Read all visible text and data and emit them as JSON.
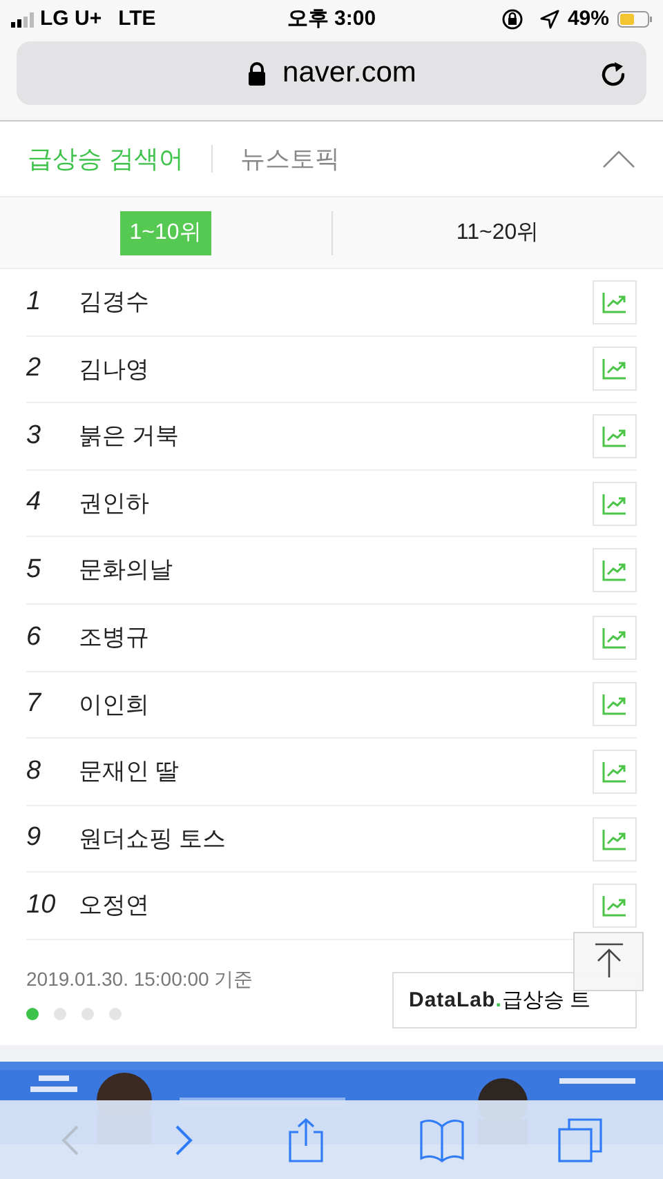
{
  "status_bar": {
    "carrier": "LG U+",
    "network": "LTE",
    "time": "오후 3:00",
    "battery": "49%"
  },
  "address_bar": {
    "url": "naver.com"
  },
  "section_tabs": [
    {
      "label": "급상승 검색어",
      "selected": true
    },
    {
      "label": "뉴스토픽",
      "selected": false
    }
  ],
  "range_tabs": [
    {
      "label": "1~10위",
      "selected": true
    },
    {
      "label": "11~20위",
      "selected": false
    }
  ],
  "ranking": [
    {
      "rank": "1",
      "keyword": "김경수"
    },
    {
      "rank": "2",
      "keyword": "김나영"
    },
    {
      "rank": "3",
      "keyword": "붉은 거북"
    },
    {
      "rank": "4",
      "keyword": "권인하"
    },
    {
      "rank": "5",
      "keyword": "문화의날"
    },
    {
      "rank": "6",
      "keyword": "조병규"
    },
    {
      "rank": "7",
      "keyword": "이인희"
    },
    {
      "rank": "8",
      "keyword": "문재인 딸"
    },
    {
      "rank": "9",
      "keyword": "원더쇼핑 토스"
    },
    {
      "rank": "10",
      "keyword": "오정연"
    }
  ],
  "timestamp": "2019.01.30. 15:00:00 기준",
  "pages": [
    {
      "selected": true
    },
    {
      "selected": false
    },
    {
      "selected": false
    },
    {
      "selected": false
    }
  ],
  "datalab_button": {
    "logo": "DataLab",
    "logo_dot": ".",
    "label": "급상승 트"
  },
  "toolbar": [
    {
      "kind": "back",
      "disabled": true
    },
    {
      "kind": "forward",
      "disabled": false
    },
    {
      "kind": "share",
      "disabled": false
    },
    {
      "kind": "bookmarks",
      "disabled": false
    },
    {
      "kind": "tabs",
      "disabled": false
    }
  ]
}
